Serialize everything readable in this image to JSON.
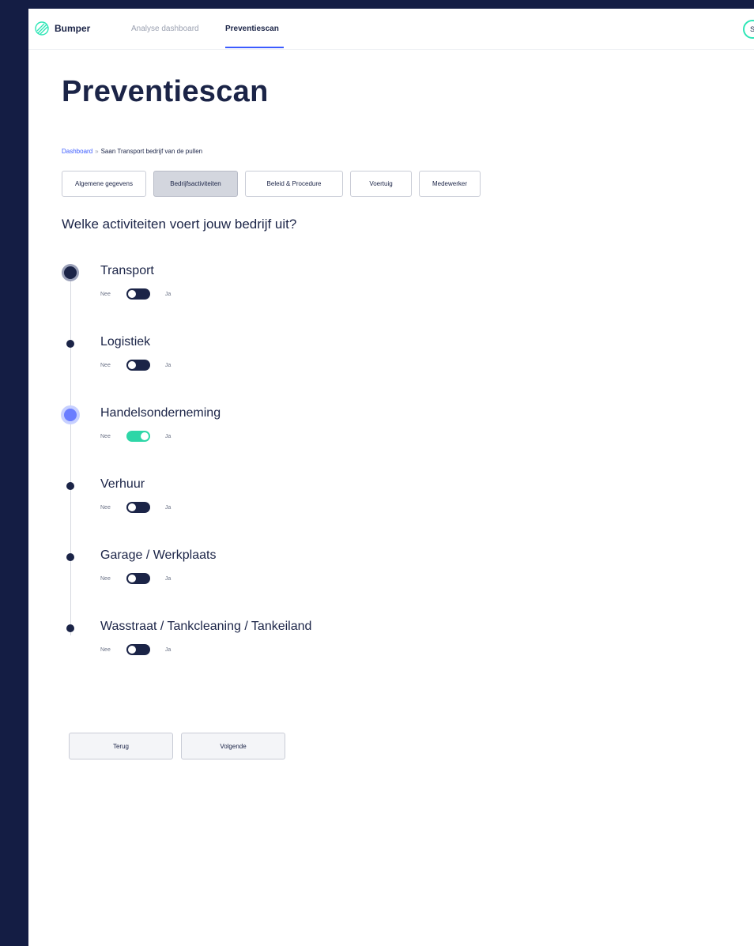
{
  "nav": {
    "brand": "Bumper",
    "links": [
      "Analyse dashboard",
      "Preventiescan"
    ],
    "active_link": "Preventiescan",
    "avatar_initial": "S"
  },
  "page": {
    "title": "Preventiescan",
    "breadcrumb": {
      "root": "Dashboard",
      "separator": "»",
      "current": "Saan Transport bedrijf van de pullen"
    }
  },
  "tabs": [
    {
      "label": "Algemene gegevens",
      "active": false
    },
    {
      "label": "Bedrijfsactiviteiten",
      "active": true
    },
    {
      "label": "Beleid & Procedure",
      "active": false
    },
    {
      "label": "Voertuig",
      "active": false
    },
    {
      "label": "Medewerker",
      "active": false
    }
  ],
  "question": "Welke activiteiten voert jouw bedrijf uit?",
  "toggle_labels": {
    "no": "Nee",
    "yes": "Ja"
  },
  "activities": [
    {
      "label": "Transport",
      "value": false
    },
    {
      "label": "Logistiek",
      "value": false
    },
    {
      "label": "Handelsonderneming",
      "value": true
    },
    {
      "label": "Verhuur",
      "value": false
    },
    {
      "label": "Garage / Werkplaats",
      "value": false
    },
    {
      "label": "Wasstraat / Tankcleaning / Tankeiland",
      "value": false
    }
  ],
  "buttons": {
    "back": "Terug",
    "next": "Volgende"
  },
  "colors": {
    "accent": "#3b5bff",
    "toggle_on": "#2ed6a7",
    "navy": "#1b2447"
  }
}
